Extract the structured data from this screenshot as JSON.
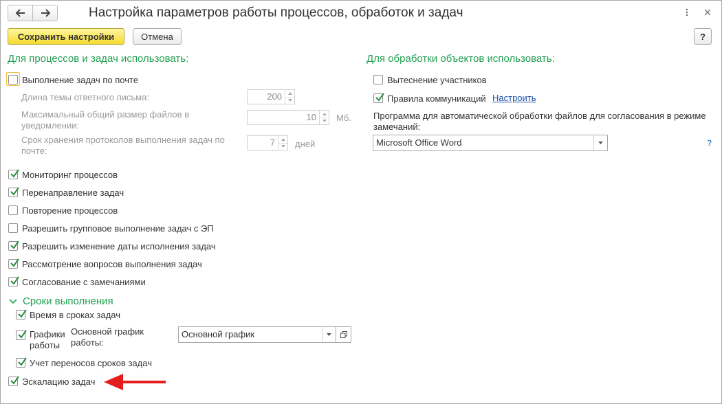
{
  "window": {
    "title": "Настройка параметров работы процессов, обработок и задач",
    "help_label": "?"
  },
  "toolbar": {
    "save_label": "Сохранить настройки",
    "cancel_label": "Отмена"
  },
  "left": {
    "header": "Для процессов и задач использовать:",
    "mail_tasks": {
      "label": "Выполнение задач по почте",
      "checked": false
    },
    "reply_subject_length": {
      "label": "Длина темы ответного письма:",
      "value": "200"
    },
    "max_files_size": {
      "label": "Максимальный общий размер файлов в уведомлении:",
      "value": "10",
      "unit": "Мб."
    },
    "log_retention": {
      "label": "Срок хранения протоколов выполнения задач по почте:",
      "value": "7",
      "unit": "дней"
    },
    "options": [
      {
        "label": "Мониторинг процессов",
        "checked": true
      },
      {
        "label": "Перенаправление задач",
        "checked": true
      },
      {
        "label": "Повторение процессов",
        "checked": false
      },
      {
        "label": "Разрешить групповое выполнение задач с ЭП",
        "checked": false
      },
      {
        "label": "Разрешить изменение даты исполнения задач",
        "checked": true
      },
      {
        "label": "Рассмотрение вопросов выполнения задач",
        "checked": true
      },
      {
        "label": "Согласование с замечаниями",
        "checked": true
      }
    ],
    "deadlines": {
      "header": "Сроки выполнения",
      "time_in_deadlines": {
        "label": "Время в сроках задач",
        "checked": true
      },
      "work_schedules": {
        "label": "Графики работы",
        "checked": true
      },
      "main_schedule_label": "Основной график работы:",
      "main_schedule_value": "Основной график",
      "deadline_transfers": {
        "label": "Учет переносов сроков задач",
        "checked": true
      }
    },
    "escalation": {
      "label": "Эскалацию задач",
      "checked": true
    }
  },
  "right": {
    "header": "Для обработки объектов использовать:",
    "displacement": {
      "label": "Вытеснение участников",
      "checked": false
    },
    "communication_rules": {
      "label": "Правила коммуникаций",
      "checked": true,
      "configure_label": "Настроить"
    },
    "file_program_label": "Программа для автоматической обработки файлов для согласования в режиме замечаний:",
    "file_program_value": "Microsoft Office Word",
    "help_label": "?"
  },
  "colors": {
    "accent_green": "#21a051",
    "primary_button": "#f5dc2e",
    "link_blue": "#1a4ea8",
    "arrow_red": "#e41e1e"
  }
}
